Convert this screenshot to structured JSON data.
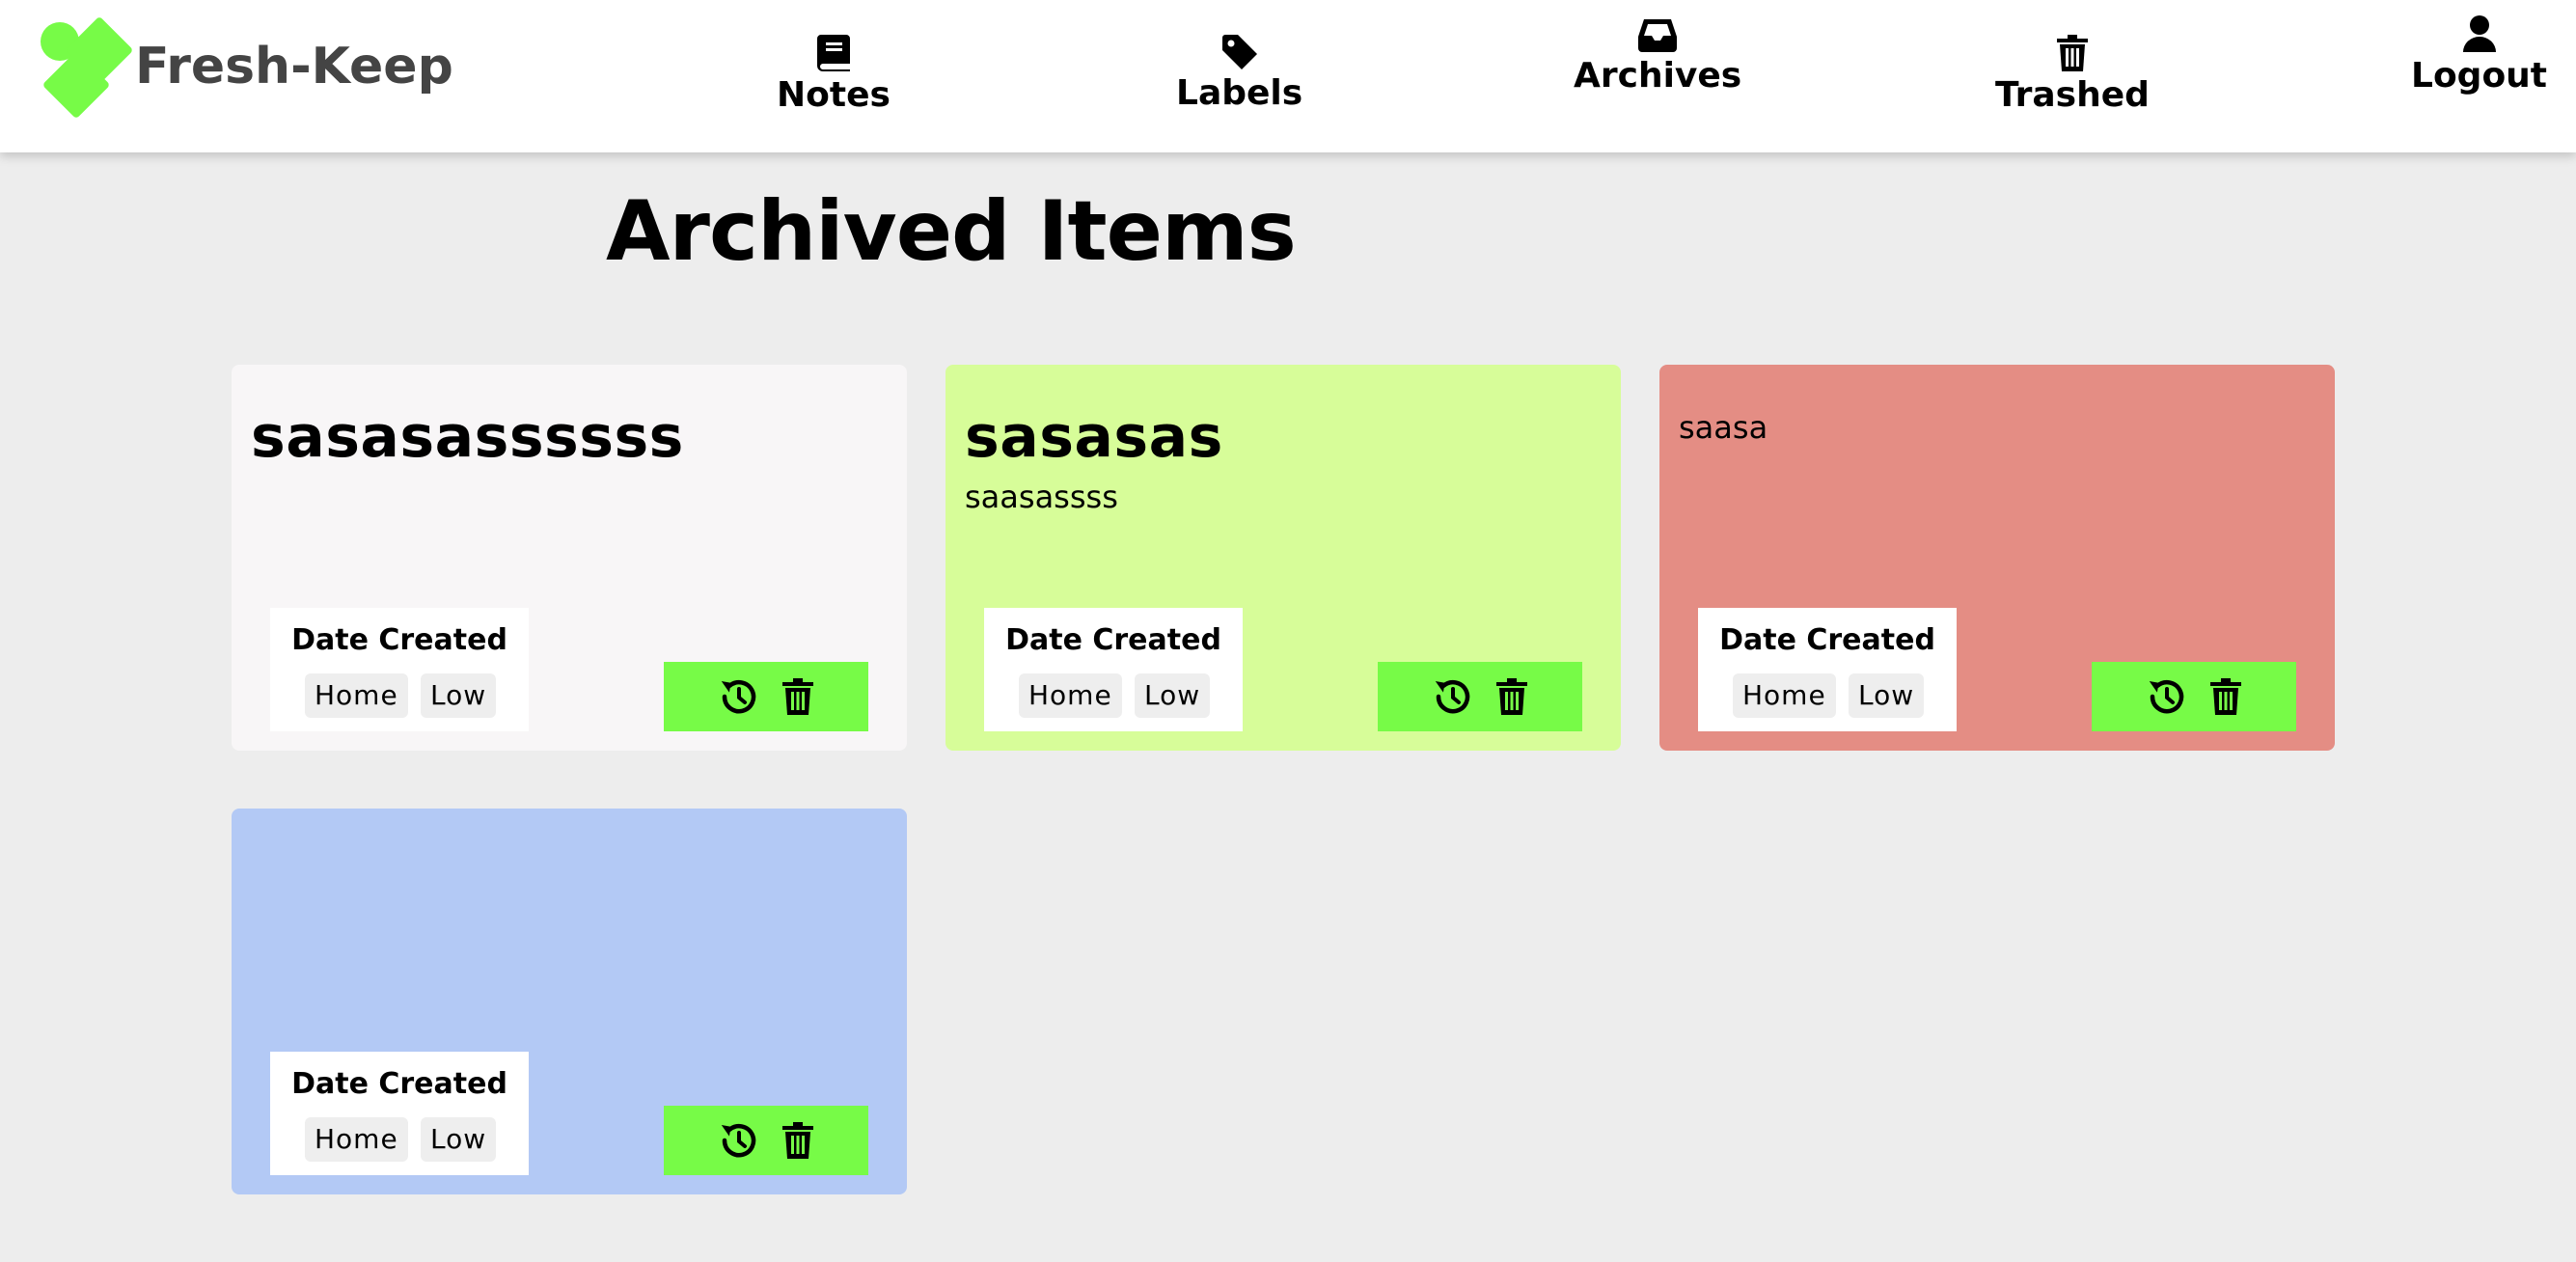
{
  "app": {
    "brand_name": "Fresh-Keep",
    "accent_color": "#77fb47"
  },
  "nav": {
    "notes": "Notes",
    "labels": "Labels",
    "archives": "Archives",
    "trashed": "Trashed",
    "logout": "Logout"
  },
  "page": {
    "title": "Archived Items"
  },
  "cards": [
    {
      "title": "sasasassssss",
      "body": "",
      "background": "#f8f6f7",
      "date_label": "Date Created",
      "tags": [
        "Home",
        "Low"
      ]
    },
    {
      "title": "sasasas",
      "body": "saasassss",
      "background": "#d7fd99",
      "date_label": "Date Created",
      "tags": [
        "Home",
        "Low"
      ]
    },
    {
      "title": "",
      "body": "saasa",
      "background": "#e48d84",
      "date_label": "Date Created",
      "tags": [
        "Home",
        "Low"
      ]
    },
    {
      "title": "",
      "body": "",
      "background": "#b3c9f5",
      "date_label": "Date Created",
      "tags": [
        "Home",
        "Low"
      ]
    }
  ],
  "icons": {
    "notes": "book-icon",
    "labels": "tag-icon",
    "archives": "inbox-icon",
    "trashed": "trash-icon",
    "logout": "user-icon",
    "restore": "history-icon",
    "delete": "trash-icon"
  }
}
